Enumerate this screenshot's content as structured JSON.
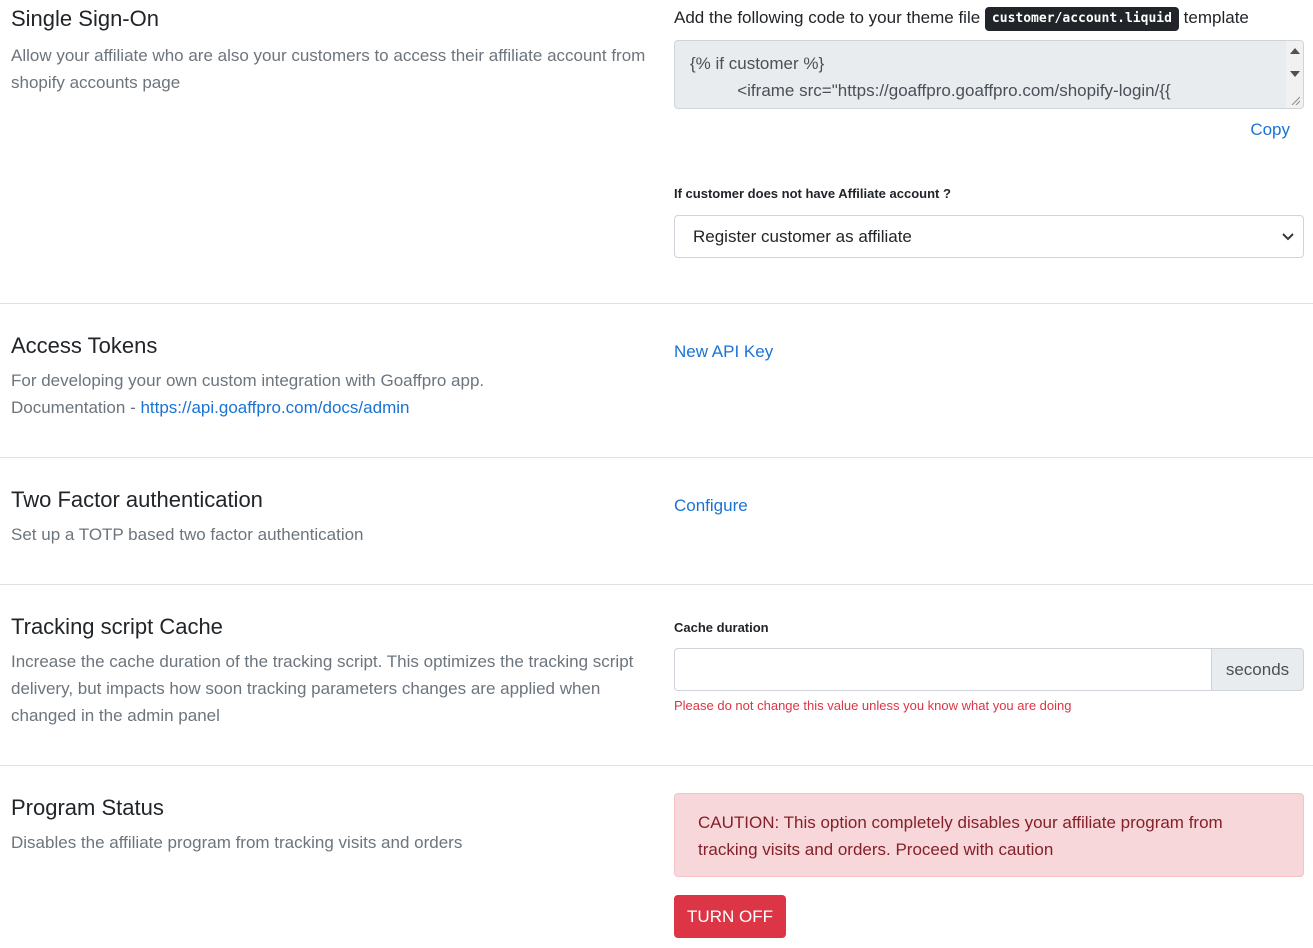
{
  "sso": {
    "title": "Single Sign-On",
    "description": "Allow your affiliate who are also your customers to access their affiliate account from shopify accounts page",
    "instruction_prefix": "Add the following code to your theme file",
    "file_name": "customer/account.liquid",
    "instruction_suffix": "template",
    "code_line_1": "{% if customer %}",
    "code_line_2": "          <iframe src=\"https://goaffpro.goaffpro.com/shopify-login/{{",
    "copy_label": "Copy",
    "no_account_label": "If customer does not have Affiliate account ?",
    "no_account_selected": "Register customer as affiliate"
  },
  "access_tokens": {
    "title": "Access Tokens",
    "description_line_1": "For developing your own custom integration with Goaffpro app.",
    "doc_label": "Documentation - ",
    "doc_link": "https://api.goaffpro.com/docs/admin",
    "action_label": "New API Key"
  },
  "two_factor": {
    "title": "Two Factor authentication",
    "description": "Set up a TOTP based two factor authentication",
    "action_label": "Configure"
  },
  "tracking_cache": {
    "title": "Tracking script Cache",
    "description": "Increase the cache duration of the tracking script. This optimizes the tracking script delivery, but impacts how soon tracking parameters changes are applied when changed in the admin panel",
    "field_label": "Cache duration",
    "field_value": "",
    "addon": "seconds",
    "warning": "Please do not change this value unless you know what you are doing"
  },
  "program_status": {
    "title": "Program Status",
    "description": "Disables the affiliate program from tracking visits and orders",
    "caution": "CAUTION: This option completely disables your affiliate program from tracking visits and orders. Proceed with caution",
    "button_label": "TURN OFF"
  },
  "colors": {
    "link": "#1a73d4",
    "danger": "#dc3545",
    "alert_bg": "#f8d7da",
    "alert_text": "#842029",
    "muted": "#6c757d"
  },
  "icons": {
    "select_chevron": "chevron-down-icon",
    "scroll_up": "arrow-up-icon",
    "scroll_down": "arrow-down-icon",
    "resize": "resize-grip-icon"
  }
}
